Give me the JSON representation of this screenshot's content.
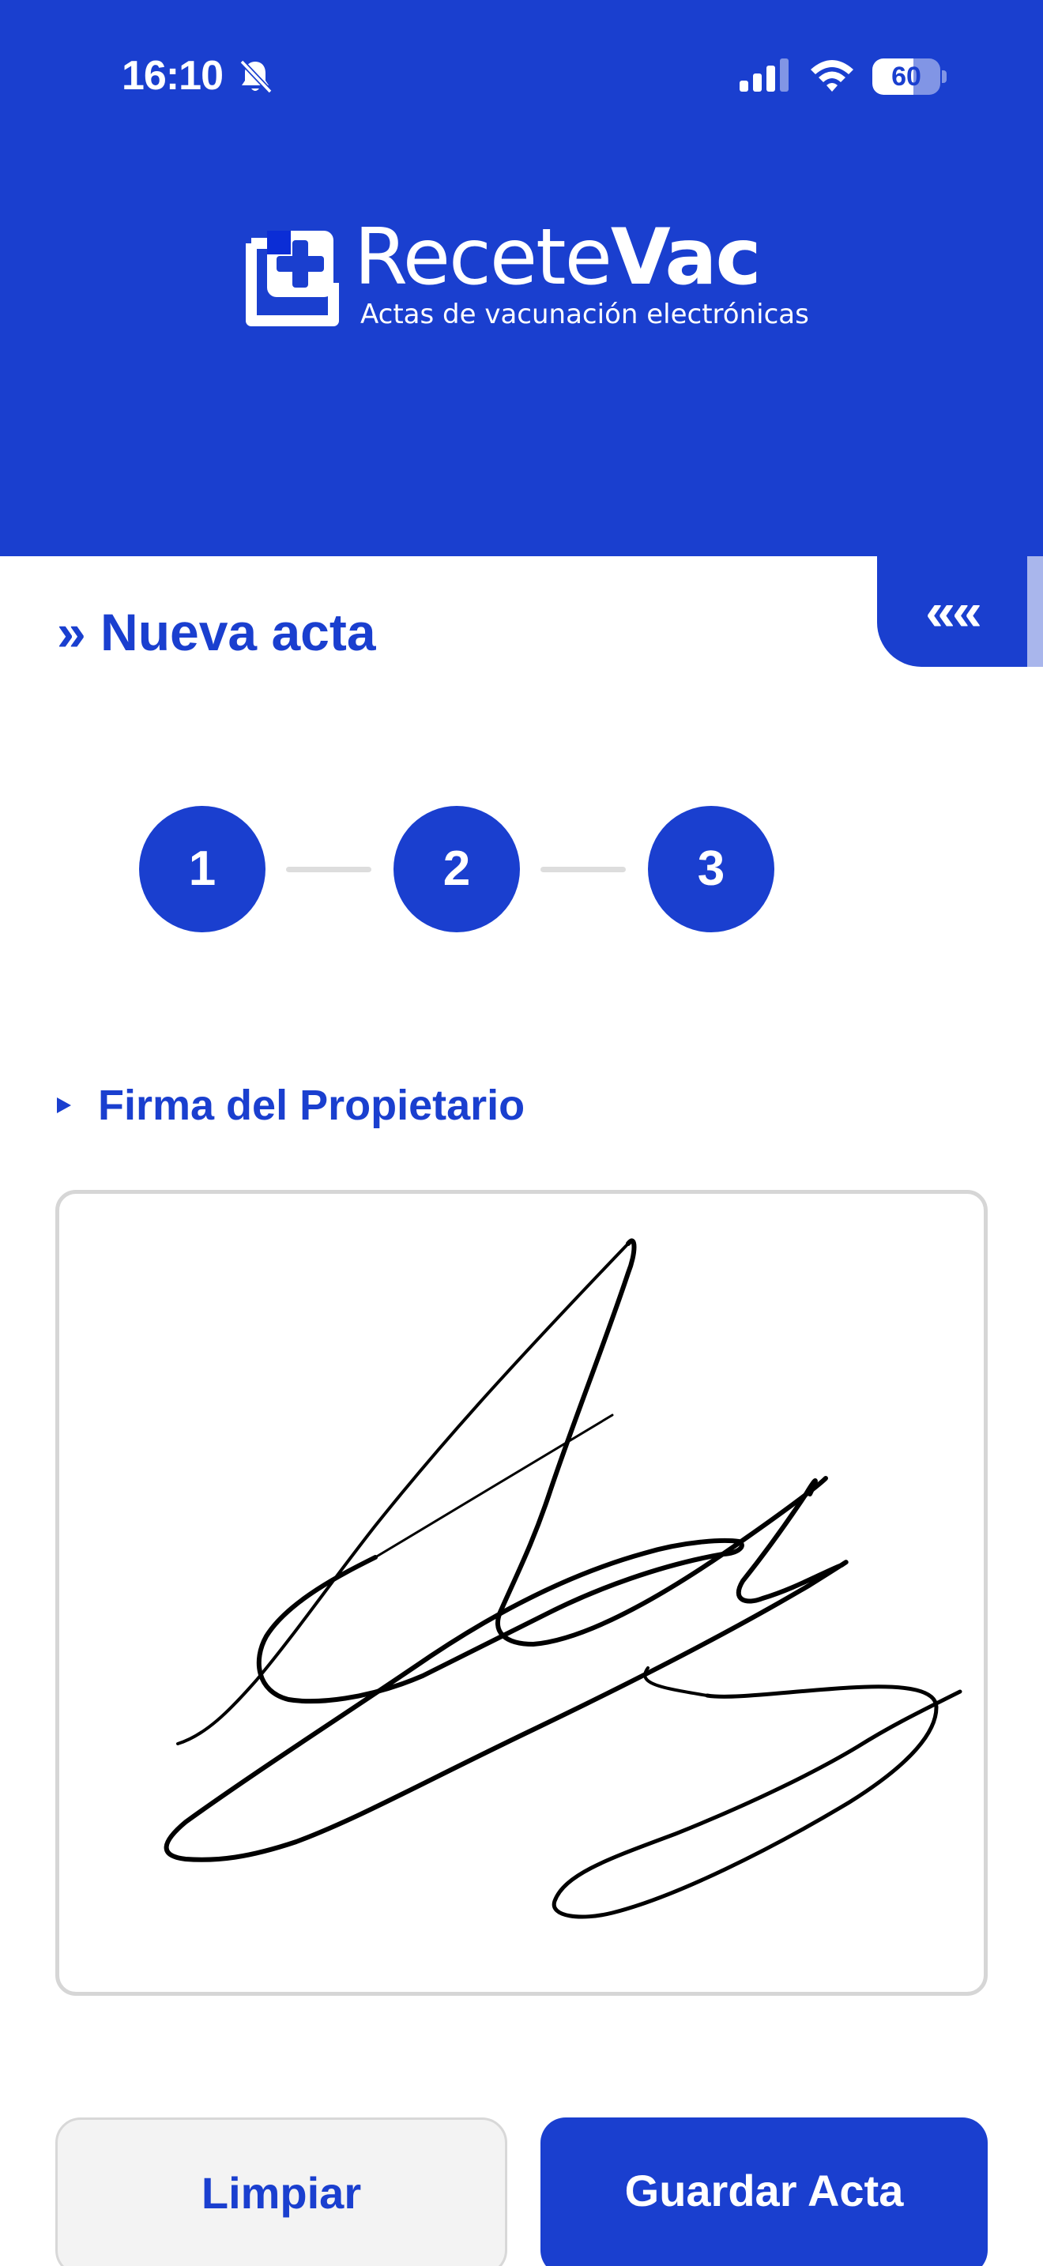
{
  "status_bar": {
    "time": "16:10",
    "battery_level": "60",
    "icons": [
      "bell-slash-icon",
      "cellular-signal-icon",
      "wifi-icon",
      "battery-icon"
    ]
  },
  "brand": {
    "name_part1": "Recete",
    "name_part2": "Vac",
    "tagline": "Actas de vacunación electrónicas",
    "logo_icon": "medical-cross-icon"
  },
  "nav": {
    "collapse_label": "««"
  },
  "page": {
    "title": "» Nueva acta"
  },
  "steps": [
    {
      "label": "1"
    },
    {
      "label": "2"
    },
    {
      "label": "3"
    }
  ],
  "signature_section": {
    "label": "Firma del Propietario"
  },
  "actions": {
    "clear_label": "Limpiar",
    "save_label": "Guardar Acta"
  },
  "colors": {
    "brand_blue": "#1a3fcf",
    "surface": "#ffffff",
    "secondary_button": "#f3f3f3",
    "border": "#d6d6d6"
  }
}
